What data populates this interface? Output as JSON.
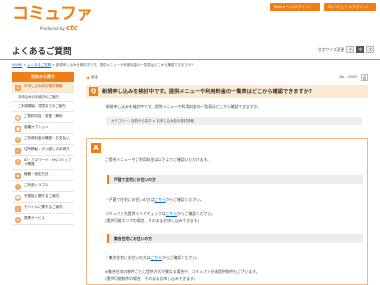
{
  "header": {
    "logo": "コミュファ",
    "logo_sub_prefix": "Produced by",
    "logo_sub_brand": "ctc",
    "btn_web": "Webメール(ログイン)",
    "btn_mypage": "Myコミュファ(ログイン)"
  },
  "page_title": "よくあるご質問",
  "font_size": {
    "label": "文字サイズ変更",
    "small": "小",
    "medium": "中",
    "large": "大"
  },
  "breadcrumb": {
    "home": "HOME",
    "faq": "よくあるご質問",
    "current": "新規申し込みを検討中です。提供メニューや利用料金の一覧表はどこから確認できますか?",
    "sep": ">"
  },
  "sidebar": {
    "heading": "目的から探す",
    "items": [
      {
        "label": "お申し込み前の検討情報",
        "active": true,
        "icon": "doc-icon"
      },
      {
        "label": "お申込みの手続きのご案内",
        "sub": true
      },
      {
        "label": "ご利用開始・環境までのご案内",
        "sub": true
      },
      {
        "label": "ご契約内容・変更・解約",
        "icon": "user-icon"
      },
      {
        "label": "各種オプション",
        "icon": "option-icon"
      },
      {
        "label": "ご利用料金の確認・お支払い",
        "icon": "yen-icon"
      },
      {
        "label": "住所移転・引っ越しの手続き",
        "icon": "home-icon"
      },
      {
        "label": "ID・パスワード・Myコミュファ関連",
        "icon": "key-icon"
      },
      {
        "label": "機器・設定方法",
        "icon": "device-icon"
      },
      {
        "label": "ご利用トラブル",
        "icon": "alert-icon"
      },
      {
        "label": "光電話に関するご案内",
        "icon": "phone-icon"
      },
      {
        "label": "モバイルに関するご案内",
        "icon": "mobile-icon"
      },
      {
        "label": "提携サービス",
        "icon": "service-icon"
      }
    ]
  },
  "main": {
    "back": "戻る",
    "no_label": "No : 2083",
    "print": "印刷",
    "question": "新規申し込みを検討中です。提供メニューや利用料金の一覧表はどこから確認できますか?",
    "qdesc": "新規申し込みを検討中です。提供メニューや利用料金の一覧表はどこから確認できますか。",
    "category": "カテゴリー : 目的から探す > お申し込み前の検討情報",
    "answer": {
      "intro": "ご提供メニューやご利用料金は以下よりご確認いただけます。",
      "section1": "戸建て住宅にお住いの方",
      "s1_line_prefix": "・戸建て住宅にお住いの方は",
      "s1_link": "こちら",
      "s1_line_suffix": "からご確認ください。",
      "area_prefix": "コミュファ光提供エリアチェックは",
      "area_link": "こちら",
      "area_suffix": "からご確認ください。",
      "area_note": "(提供可能エリアの場合、そのままお申し込みできます)",
      "section2": "集合住宅にお住いの方",
      "s2_line_prefix": "・集合住宅にお住いの方は",
      "s2_link": "こちら",
      "s2_line_suffix": "からご確認ください。",
      "note1": "※集合住宅の物件ごとに提供方式が異なる場合や、コミュファ光未提供物件もございます。",
      "note2": "(提供可能物件の場合、そのままお申し込みできます)"
    }
  }
}
